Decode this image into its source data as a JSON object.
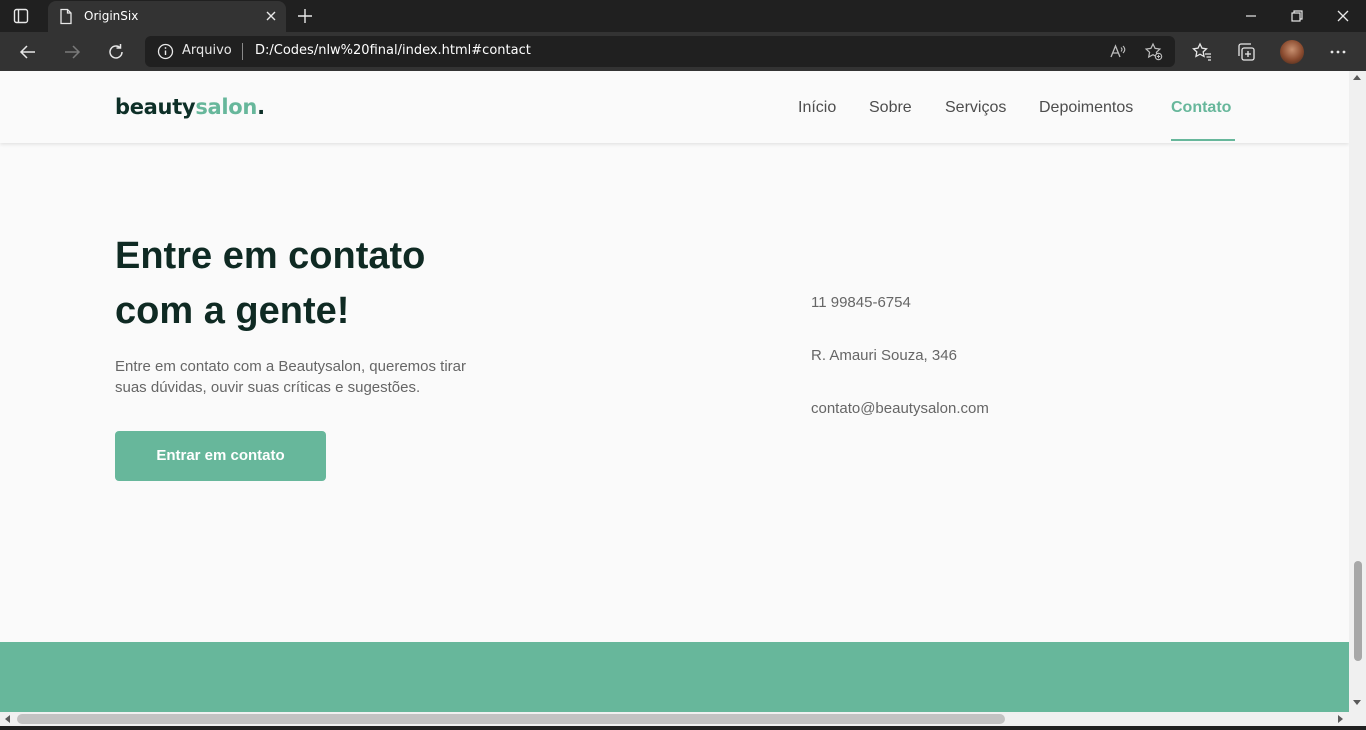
{
  "browser": {
    "tab_title": "OriginSix",
    "address_label": "Arquivo",
    "url": "D:/Codes/nlw%20final/index.html#contact",
    "icons": [
      "tab-actions-icon",
      "page-icon",
      "close-icon",
      "plus-icon",
      "minimize-icon",
      "restore-icon",
      "close-window-icon",
      "back-icon",
      "forward-icon",
      "refresh-icon",
      "info-icon",
      "read-aloud-icon",
      "add-favorite-icon",
      "favorites-icon",
      "collections-icon",
      "profile-avatar",
      "more-icon"
    ]
  },
  "site": {
    "logo": {
      "part1": "beauty",
      "part2": "salon",
      "part3": "."
    },
    "nav": {
      "items": [
        {
          "label": "Início"
        },
        {
          "label": "Sobre"
        },
        {
          "label": "Serviços"
        },
        {
          "label": "Depoimentos"
        },
        {
          "label": "Contato",
          "active": true
        }
      ]
    },
    "contact": {
      "heading_line1": "Entre em contato",
      "heading_line2": "com a gente!",
      "text_line1": "Entre em contato com a Beautysalon, queremos tirar",
      "text_line2": "suas dúvidas, ouvir suas críticas e sugestões.",
      "button_label": "Entrar em contato",
      "phone": "11 99845-6754",
      "address": "R. Amauri Souza, 346",
      "email": "contato@beautysalon.com"
    }
  },
  "colors": {
    "accent": "#67b79b",
    "heading": "#0f2a23",
    "text": "#666666",
    "page_bg": "#fafafa",
    "chrome_dark": "#202020",
    "chrome_mid": "#333333"
  }
}
